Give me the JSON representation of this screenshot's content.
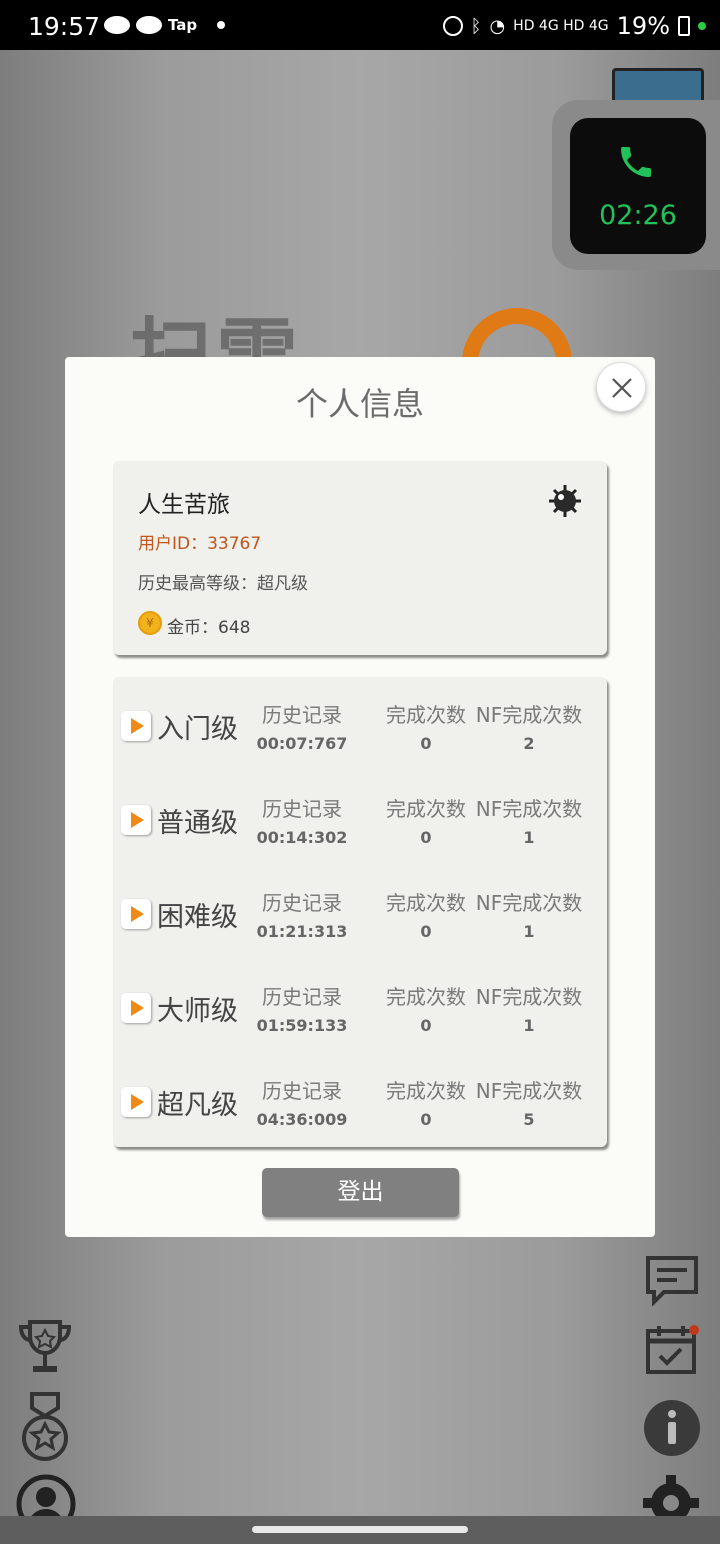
{
  "status_bar": {
    "time": "19:57",
    "app_label": "Tap",
    "network": "HD 4G HD 4G",
    "battery": "19%"
  },
  "call_widget": {
    "duration": "02:26",
    "accent_color": "#22c25a"
  },
  "modal": {
    "title": "个人信息",
    "close_icon": "close-icon",
    "user": {
      "name": "人生苦旅",
      "user_id": "用户ID：33767",
      "highest_level": "历史最高等级：超凡级",
      "coins": "金币：648",
      "coin_symbol": "¥"
    },
    "levels": [
      {
        "name": "入门级",
        "record_label": "历史记录",
        "record": "00:07:767",
        "done_label": "完成次数",
        "done": "0",
        "nf_label": "NF完成次数",
        "nf": "2"
      },
      {
        "name": "普通级",
        "record_label": "历史记录",
        "record": "00:14:302",
        "done_label": "完成次数",
        "done": "0",
        "nf_label": "NF完成次数",
        "nf": "1"
      },
      {
        "name": "困难级",
        "record_label": "历史记录",
        "record": "01:21:313",
        "done_label": "完成次数",
        "done": "0",
        "nf_label": "NF完成次数",
        "nf": "1"
      },
      {
        "name": "大师级",
        "record_label": "历史记录",
        "record": "01:59:133",
        "done_label": "完成次数",
        "done": "0",
        "nf_label": "NF完成次数",
        "nf": "1"
      },
      {
        "name": "超凡级",
        "record_label": "历史记录",
        "record": "04:36:009",
        "done_label": "完成次数",
        "done": "0",
        "nf_label": "NF完成次数",
        "nf": "5"
      }
    ],
    "logout_label": "登出"
  },
  "side_icons": {
    "left": [
      "trophy-icon",
      "medal-icon",
      "profile-icon"
    ],
    "right": [
      "chat-icon",
      "calendar-icon",
      "info-icon",
      "settings-icon"
    ]
  }
}
